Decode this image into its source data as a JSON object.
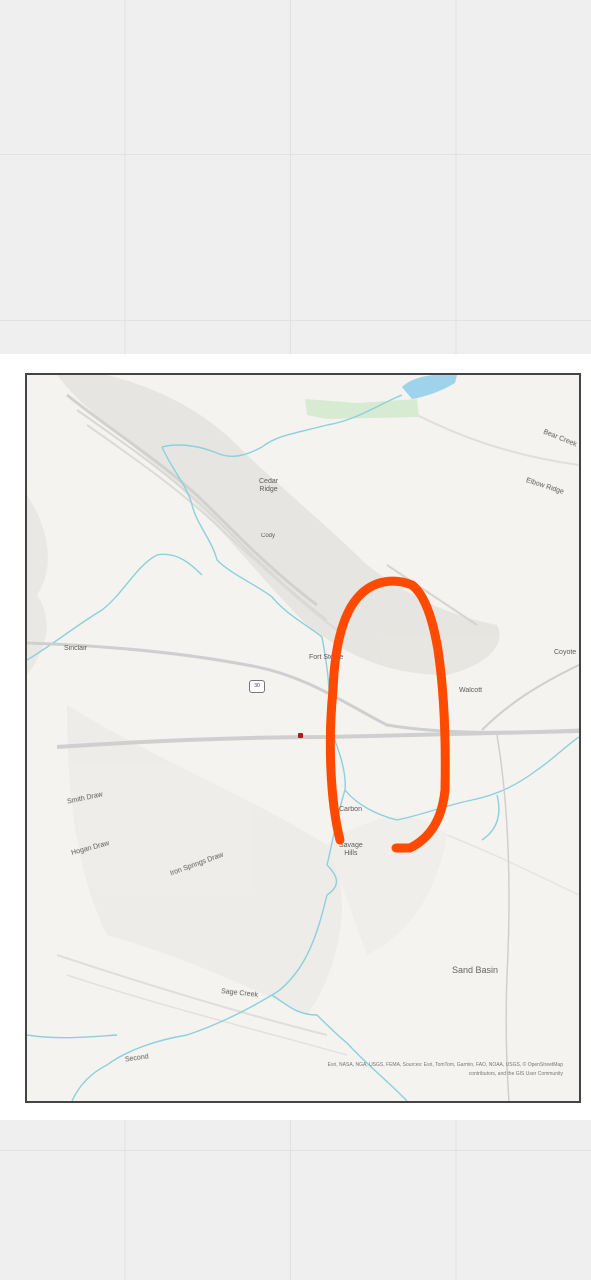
{
  "map": {
    "labels": {
      "cedar_ridge": "Cedar\nRidge",
      "peak": "Cody",
      "elbow_ridge": "Elbow Ridge",
      "bear_creek": "Bear Creek",
      "sinclair": "Sinclair",
      "fort_steele": "Fort Steele",
      "walcott": "Walcott",
      "coyote": "Coyote",
      "smith_draw": "Smith Draw",
      "hogan_draw": "Hogan Draw",
      "iron_springs_draw": "Iron Springs Draw",
      "carbon": "Carbon",
      "savage_hills": "Savage\nHills",
      "sand_basin": "Sand Basin",
      "sage_creek": "Sage Creek",
      "second_creek": "Second"
    },
    "route_shield": "30",
    "attribution": "Esri, NASA, NGA, USGS, FEMA, Sources: Esri, TomTom, Garmin, FAO, NOAA, USGS, © OpenStreetMap contributors, and the GIS User Community",
    "colors": {
      "rivers": "#8cd0dd",
      "lake": "#9fd3ec",
      "roads": "#cfcfcf",
      "annotation": "#ff4a00",
      "location_marker": "#c0141b"
    }
  }
}
